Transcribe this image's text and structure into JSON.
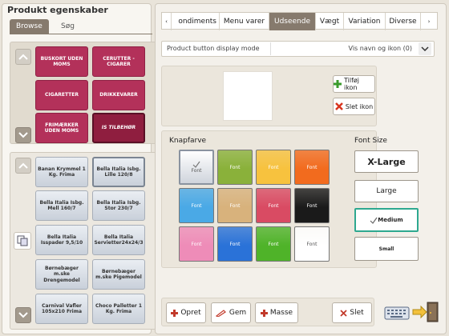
{
  "sidebar": {
    "title": "Produkt egenskaber",
    "tabs": [
      "Browse",
      "Søg"
    ],
    "categories": [
      {
        "label": "BUSKORT UDEN MOMS"
      },
      {
        "label": "CERUTTER - CIGARER"
      },
      {
        "label": "CIGARETTER"
      },
      {
        "label": "DRIKKEVARER"
      },
      {
        "label": "FRIMÆRKER UDEN MOMS"
      },
      {
        "label": "IS TILBEHØR"
      }
    ],
    "products": [
      {
        "label": "Banan Krymmel 1 Kg. Frima"
      },
      {
        "label": "Bella Italia Isbg. Lille 120/8"
      },
      {
        "label": "Bella Italia Isbg. Mell 160/7"
      },
      {
        "label": "Bella Italia Isbg. Stor 230/7"
      },
      {
        "label": "Bella Italia Isspader 9,5/10"
      },
      {
        "label": "Bella Italia Servietter24x24/3"
      },
      {
        "label": "Børnebæger m.ske Drengemodel"
      },
      {
        "label": "Børnebæger m.ske Pigemodel"
      },
      {
        "label": "Carnival Vafler 105x210 Frima"
      },
      {
        "label": "Choco Palletter 1 Kg. Frima"
      }
    ]
  },
  "tabs": [
    "ondiments",
    "Menu varer",
    "Udseende",
    "Vægt",
    "Variation",
    "Diverse"
  ],
  "display_mode": {
    "label": "Product button display mode",
    "value": "Vis navn og ikon (0)"
  },
  "icon_buttons": {
    "add": "Tilføj ikon",
    "delete": "Slet ikon"
  },
  "colors": {
    "title": "Knapfarve",
    "swatch_label": "Font",
    "swatches": [
      "#f2f2f2",
      "#8ab13a",
      "#f7c23e",
      "#f26b1e",
      "#4aa9e6",
      "#d8b27c",
      "#d94b63",
      "#1a1a1a",
      "#ee8cb8",
      "#2a72d8",
      "#4fb329",
      "#ffffff"
    ]
  },
  "font_size": {
    "title": "Font Size",
    "options": [
      "X-Large",
      "Large",
      "Medium",
      "Small"
    ],
    "selected": "Medium"
  },
  "actions": {
    "create": "Opret",
    "save": "Gem",
    "mass": "Masse",
    "delete": "Slet"
  }
}
